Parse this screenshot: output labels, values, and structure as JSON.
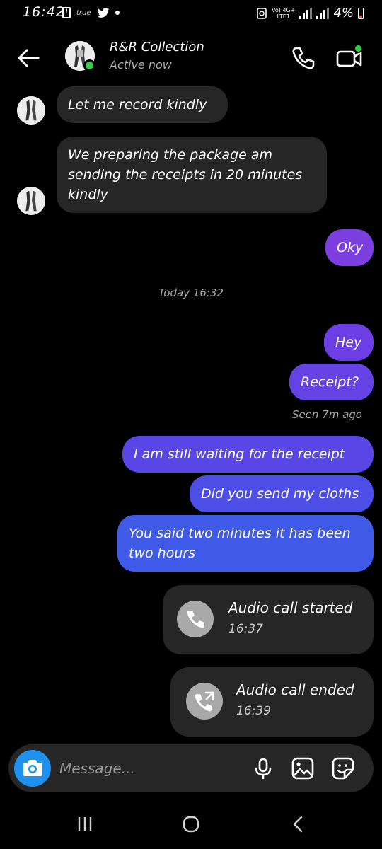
{
  "status_bar": {
    "time": "16:42",
    "carrier_tag": "true",
    "network": "Vo) 4G+",
    "lte": "LTE1",
    "battery": "4%"
  },
  "header": {
    "contact_name": "R&R Collection",
    "contact_status": "Active now",
    "icons": [
      "arrow-left-icon",
      "phone-icon",
      "video-camera-icon"
    ]
  },
  "messages": {
    "m1": "Let me record kindly",
    "m2": "We preparing the package am sending the receipts in 20 minutes kindly",
    "m3": "Oky",
    "timestamp": "Today 16:32",
    "m4": "Hey",
    "m5": "Receipt?",
    "seen": "Seen 7m ago",
    "m6": "I am still waiting for the receipt",
    "m7": "Did you send my cloths",
    "m8": "You said two minutes it has been two hours"
  },
  "calls": {
    "c1_title": "Audio call started",
    "c1_time": "16:37",
    "c2_title": "Audio call ended",
    "c2_time": "16:39"
  },
  "composer": {
    "placeholder": "Message...",
    "icons": [
      "camera-icon",
      "microphone-icon",
      "gallery-icon",
      "sticker-icon"
    ]
  },
  "colors": {
    "outgoing_purple": "#7b3fe0",
    "outgoing_indigo": "#5a45e6",
    "outgoing_blue": "#3f5ae6",
    "incoming": "#262626",
    "online": "#2fd047",
    "camera": "#1e90f0"
  }
}
